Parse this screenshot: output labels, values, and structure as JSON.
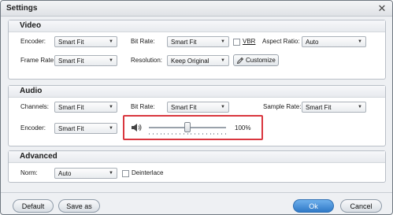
{
  "window": {
    "title": "Settings",
    "close_glyph": "✕"
  },
  "video": {
    "section_title": "Video",
    "encoder_label": "Encoder:",
    "encoder_value": "Smart Fit",
    "bitrate_label": "Bit Rate:",
    "bitrate_value": "Smart Fit",
    "vbr_label": "VBR",
    "vbr_checked": false,
    "aspect_label": "Aspect Ratio:",
    "aspect_value": "Auto",
    "framerate_label": "Frame Rate:",
    "framerate_value": "Smart Fit",
    "resolution_label": "Resolution:",
    "resolution_value": "Keep Original",
    "customize_label": "Customize"
  },
  "audio": {
    "section_title": "Audio",
    "channels_label": "Channels:",
    "channels_value": "Smart Fit",
    "bitrate_label": "Bit Rate:",
    "bitrate_value": "Smart Fit",
    "samplerate_label": "Sample Rate:",
    "samplerate_value": "Smart Fit",
    "encoder_label": "Encoder:",
    "encoder_value": "Smart Fit",
    "volume_text": "100%",
    "volume_level": 0.5
  },
  "advanced": {
    "section_title": "Advanced",
    "norm_label": "Norm:",
    "norm_value": "Auto",
    "deinterlace_label": "Deinterlace",
    "deinterlace_checked": false
  },
  "footer": {
    "default_label": "Default",
    "saveas_label": "Save as",
    "ok_label": "Ok",
    "cancel_label": "Cancel"
  },
  "colors": {
    "highlight": "#d9363e",
    "primary": "#2f79c7",
    "section_bg": "#ffffff",
    "window_bg": "#eef0f3"
  },
  "icons": [
    "close-icon",
    "chevron-down-icon",
    "pencil-icon",
    "speaker-icon"
  ]
}
